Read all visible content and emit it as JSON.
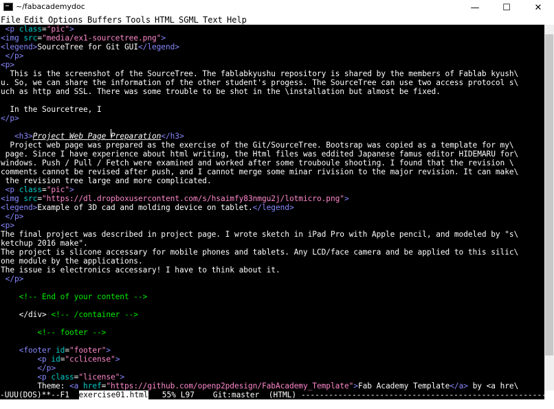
{
  "window": {
    "title": "~/fabacademydoc",
    "minimize": "—",
    "maximize": "☐",
    "close": "✕",
    "icon": "terminal-icon"
  },
  "menu": [
    "File",
    "Edit",
    "Options",
    "Buffers",
    "Tools",
    "HTML",
    "SGML",
    "Text",
    "Help"
  ],
  "editor": {
    "lines": [
      " <p class=\"pic\">",
      "<img src=\"media/ex1-sourcetree.png\">",
      "<legend>SourceTree for Git GUI</legend>",
      " </p>",
      "<p>",
      "  This is the screenshot of the SourceTree. The fablabkyushu repository is shared by the members of Fablab kyush\\",
      "u. So, we can share the information of the other student's progess. The SourceTree can use two access protocol s\\",
      "uch as http and SSL. There was some trouble to be shot in the \\installation but almost be fixed.",
      "",
      "  In the Sourcetree, I ",
      "</p>",
      "",
      "   <h3>Project Web Page Preparation</h3>",
      "  Project web page was prepared as the exercise of the Git/SourceTree. Bootsrap was copied as a template for my\\",
      " page. Since I have experience about html writing, the Html files was eddited Japanese famus editor HIDEMARU for\\",
      "windows. Push / Pull / Fetch were examined and worked after some trouboule shooting. I found that the revision \\",
      "comments cannot be revised after push, and I cannot merge some minar rivision to the major revision. It can make\\",
      " the revision tree large and more complicated.",
      " <p class=\"pic\">",
      "<img src=\"https://dl.dropboxusercontent.com/s/hsaimfy83nmgu2j/lotmicro.png\">",
      "<legend>Example of 3D cad and molding device on tablet.</legend>",
      " </p>",
      "<p>",
      "The final project was described in project page. I wrote sketch in iPad Pro with Apple pencil, and modeled by \"s\\",
      "ketchup 2016 make\".",
      "The project is slicone accessary for mobile phones and tablets. Any LCD/face camera and be applied to this silic\\",
      "one module by the applications.",
      "The issue is electronics accessary! I have to think about it.",
      " </p>",
      "",
      "    <!-- End of your content -->",
      "",
      "    </div> <!-- /container -->",
      "",
      "        <!-- footer -->",
      "",
      "    <footer id=\"footer\">",
      "        <p id=\"cclicense\">",
      "        </p>",
      "        <p class=\"license\">",
      "        Theme: <a href=\"https://github.com/openp2pdesign/FabAcademy_Template\">Fab Academy Template</a> by <a hre\\"
    ]
  },
  "modeline": {
    "status": "-UUU(DOS)**--F1  ",
    "buffer": "exercise01.html",
    "position": "55% L97",
    "vc": "Git:master",
    "mode": "(HTML)"
  },
  "colors": {
    "background": "#000000",
    "foreground": "#ffffff",
    "tag": "#8888ff",
    "attribute": "#00cccc",
    "string": "#ff88cc",
    "comment": "#00ee00"
  }
}
